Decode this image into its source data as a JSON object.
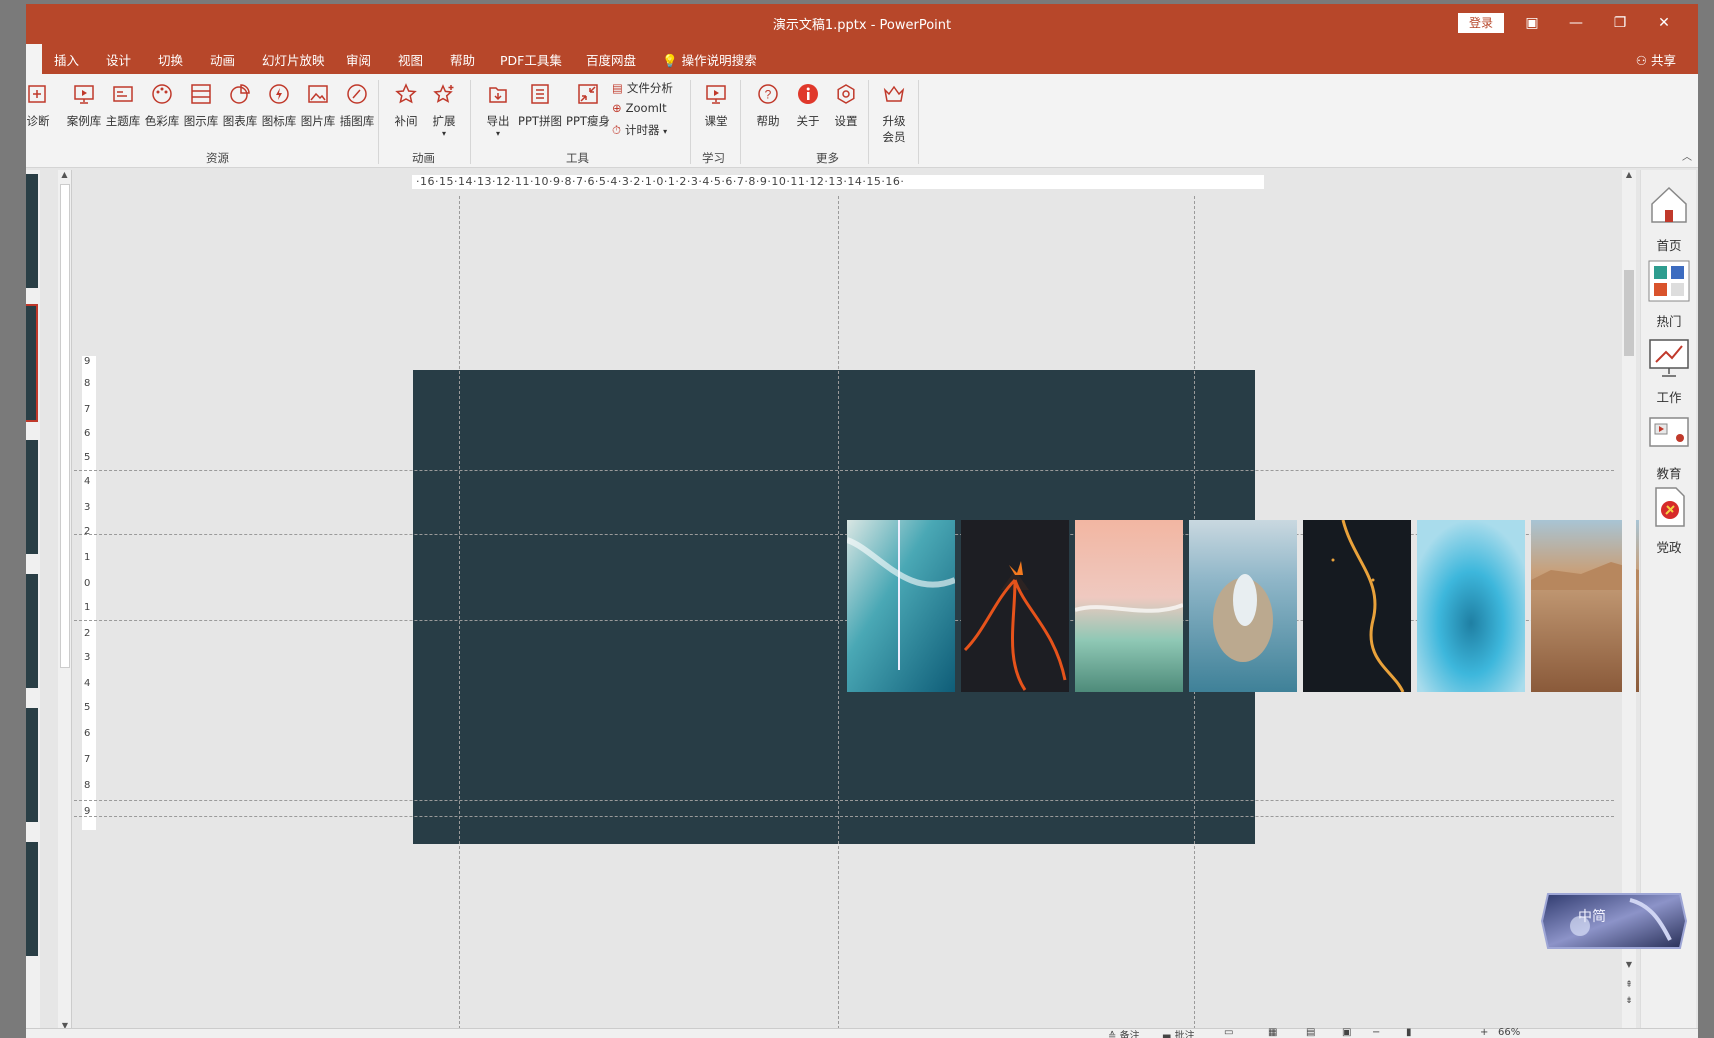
{
  "window": {
    "title": "演示文稿1.pptx  -  PowerPoint",
    "login": "登录"
  },
  "tabs": [
    "插入",
    "设计",
    "切换",
    "动画",
    "幻灯片放映",
    "审阅",
    "视图",
    "帮助",
    "PDF工具集",
    "百度网盘",
    "操作说明搜索"
  ],
  "share": "共享",
  "ribbon": {
    "diagnose": "诊断",
    "resources": [
      "案例库",
      "主题库",
      "色彩库",
      "图示库",
      "图表库",
      "图标库",
      "图片库",
      "插图库"
    ],
    "resources_label": "资源",
    "animation": [
      "补间",
      "扩展"
    ],
    "animation_label": "动画",
    "tools": [
      "导出",
      "PPT拼图",
      "PPT瘦身"
    ],
    "tools_small": [
      "文件分析",
      "ZoomIt",
      "计时器"
    ],
    "tools_label": "工具",
    "study": "课堂",
    "study_label": "学习",
    "more": [
      "帮助",
      "关于",
      "设置"
    ],
    "more_label": "更多",
    "upgrade_line1": "升级",
    "upgrade_line2": "会员"
  },
  "ruler": {
    "horizontal": "·16·15·14·13·12·11·10·9·8·7·6·5·4·3·2·1·0·1·2·3·4·5·6·7·8·9·10·11·12·13·14·15·16·",
    "vertical": [
      "9",
      "8",
      "7",
      "6",
      "5",
      "4",
      "3",
      "2",
      "1",
      "0",
      "1",
      "2",
      "3",
      "4",
      "5",
      "6",
      "7",
      "8",
      "9"
    ]
  },
  "photos": [
    "pier-ocean",
    "volcano-lava",
    "pink-salt-lake",
    "island-building",
    "night-city-road",
    "blue-ice-lake",
    "desert-dunes"
  ],
  "sidepanel": [
    "首页",
    "热门",
    "工作",
    "教育",
    "党政"
  ],
  "status": {
    "notes": "备注",
    "comments": "批注",
    "zoom": "66%"
  },
  "badge": {
    "text": "中简"
  },
  "colors": {
    "accent": "#b7472a",
    "slide_bg": "#283d46"
  }
}
